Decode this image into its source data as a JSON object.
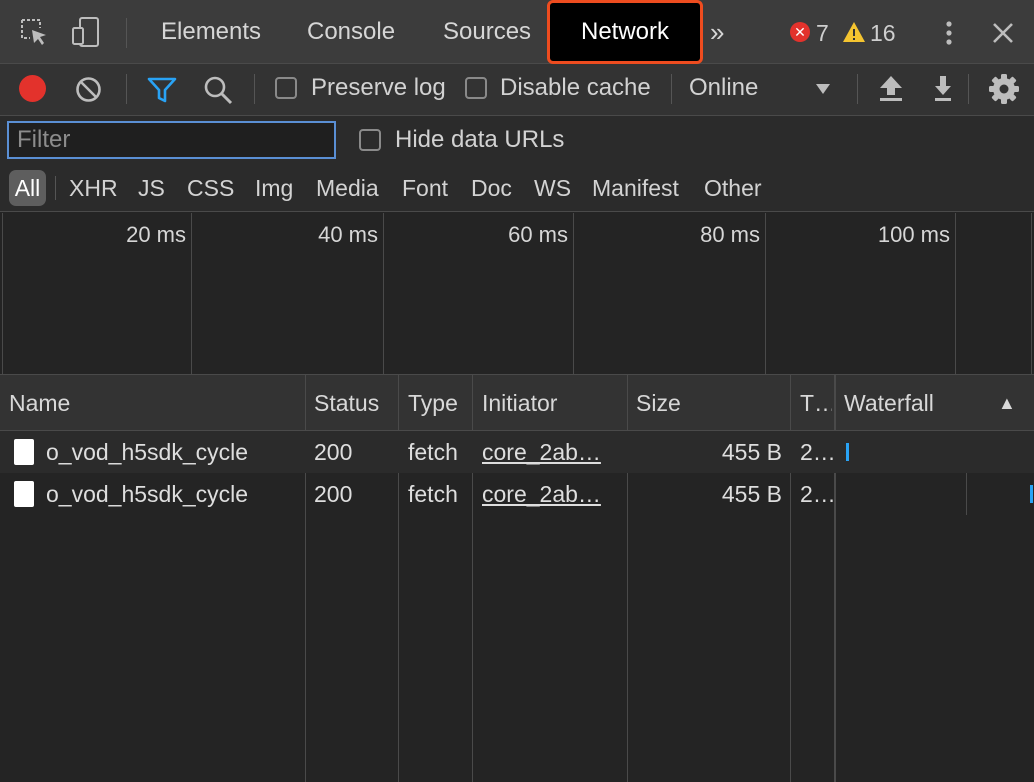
{
  "tabs": {
    "items": [
      "Elements",
      "Console",
      "Sources"
    ],
    "active": "Network",
    "more": "»",
    "errors_count": "7",
    "warnings_count": "16",
    "error_glyph": "✕",
    "warning_glyph": "!"
  },
  "toolbar": {
    "preserve_log": "Preserve log",
    "disable_cache": "Disable cache",
    "throttle": "Online"
  },
  "filter": {
    "placeholder": "Filter",
    "hide_data_urls": "Hide data URLs"
  },
  "types": [
    "All",
    "XHR",
    "JS",
    "CSS",
    "Img",
    "Media",
    "Font",
    "Doc",
    "WS",
    "Manifest",
    "Other"
  ],
  "overview": {
    "ticks": [
      "20 ms",
      "40 ms",
      "60 ms",
      "80 ms",
      "100 ms"
    ]
  },
  "table": {
    "columns": [
      "Name",
      "Status",
      "Type",
      "Initiator",
      "Size",
      "T…",
      "Waterfall"
    ],
    "sort_glyph": "▲",
    "rows": [
      {
        "name": "o_vod_h5sdk_cycle",
        "status": "200",
        "type": "fetch",
        "initiator": "core_2ab…",
        "size": "455 B",
        "time": "2…"
      },
      {
        "name": "o_vod_h5sdk_cycle",
        "status": "200",
        "type": "fetch",
        "initiator": "core_2ab…",
        "size": "455 B",
        "time": "2…"
      }
    ]
  },
  "colors": {
    "accent_blue": "#29a3f5",
    "record_red": "#e3322c",
    "active_tab_border": "#ee4c1f",
    "warning_yellow": "#f4c430"
  }
}
